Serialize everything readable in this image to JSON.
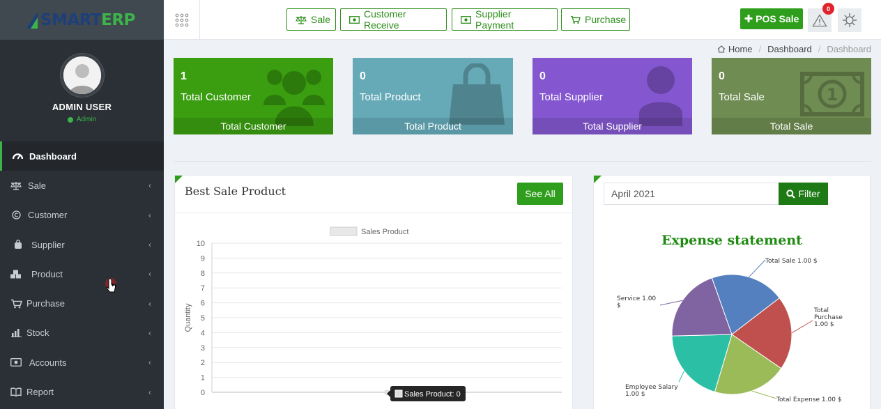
{
  "app": {
    "logo_part1": "SMART",
    "logo_part2": "ERP",
    "brand_colors": {
      "primary": "#1e3f7a",
      "accent": "#3cb44a"
    }
  },
  "user": {
    "name": "ADMIN USER",
    "role": "Admin"
  },
  "sidebar": {
    "items": [
      {
        "label": "Dashboard",
        "icon": "dashboard-gauge-icon",
        "active": true
      },
      {
        "label": "Sale",
        "icon": "scale-icon"
      },
      {
        "label": "Customer",
        "icon": "copyright-circle-icon"
      },
      {
        "label": "Supplier",
        "icon": "bag-icon"
      },
      {
        "label": "Product",
        "icon": "cubes-icon"
      },
      {
        "label": "Purchase",
        "icon": "cart-icon"
      },
      {
        "label": "Stock",
        "icon": "bar-chart-icon"
      },
      {
        "label": "Accounts",
        "icon": "money-icon"
      },
      {
        "label": "Report",
        "icon": "book-icon"
      }
    ]
  },
  "topbar": {
    "quick": [
      {
        "label": "Sale",
        "icon": "scale-icon"
      },
      {
        "label": "Customer Receive",
        "icon": "money-icon"
      },
      {
        "label": "Supplier Payment",
        "icon": "money-icon"
      },
      {
        "label": "Purchase",
        "icon": "cart-icon"
      }
    ],
    "pos_label": "POS Sale",
    "alert_count": "0"
  },
  "breadcrumb": {
    "home": "Home",
    "section": "Dashboard",
    "current": "Dashboard"
  },
  "stats": [
    {
      "value": "1",
      "label": "Total Customer",
      "footer": "Total Customer",
      "color": "#3a9e10",
      "icon": "users-icon"
    },
    {
      "value": "0",
      "label": "Total Product",
      "footer": "Total Product",
      "color": "#66aab8",
      "icon": "shopping-bag-icon"
    },
    {
      "value": "0",
      "label": "Total Supplier",
      "footer": "Total Supplier",
      "color": "#8457d0",
      "icon": "user-icon"
    },
    {
      "value": "0",
      "label": "Total Sale",
      "footer": "Total Sale",
      "color": "#6f8c52",
      "icon": "banknote-icon"
    }
  ],
  "best_sale": {
    "title": "Best Sale Product",
    "see_all": "See All",
    "tooltip": "Sales Product: 0"
  },
  "expense": {
    "date_value": "April 2021",
    "filter_label": "Filter",
    "title": "Expense statement"
  },
  "chart_data": [
    {
      "type": "line",
      "title": "",
      "series": [
        {
          "name": "Sales Product",
          "values": [
            0
          ]
        }
      ],
      "ylabel": "Quantity",
      "xlabel": "",
      "ylim": [
        0,
        10
      ],
      "yticks": [
        "0",
        "1",
        "2",
        "3",
        "4",
        "5",
        "6",
        "7",
        "8",
        "9",
        "10"
      ],
      "grid": true,
      "legend": "top"
    },
    {
      "type": "pie",
      "title": "Expense statement",
      "categories": [
        "Total Sale",
        "Total Purchase",
        "Total Expense",
        "Employee Salary",
        "Service"
      ],
      "values": [
        1.0,
        1.0,
        1.0,
        1.0,
        1.0
      ],
      "labels": [
        "Total Sale 1.00 $",
        "Total Purchase 1.00 $",
        "Total Expense 1.00 $",
        "Employee Salary 1.00 $",
        "Service 1.00 $"
      ],
      "colors": [
        "#5480c0",
        "#c0504d",
        "#9bbb59",
        "#2bbfa6",
        "#8064a2"
      ]
    }
  ]
}
